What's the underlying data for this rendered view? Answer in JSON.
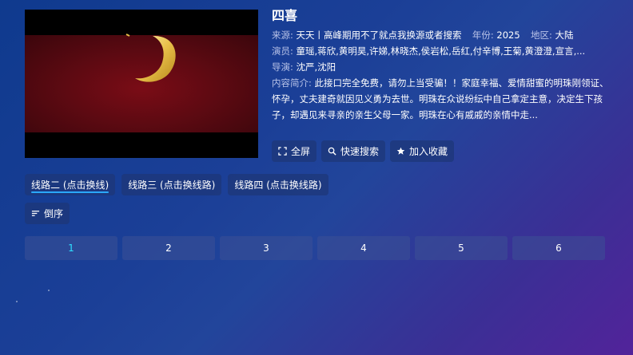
{
  "video": {
    "title": "四喜"
  },
  "meta": {
    "source_label": "来源:",
    "source_value": "天天丨高峰期用不了就点我换源或者搜索",
    "year_label": "年份:",
    "year_value": "2025",
    "region_label": "地区:",
    "region_value": "大陆",
    "cast_label": "演员:",
    "cast_value": "童瑶,蒋欣,黄明昊,许娣,林晓杰,侯岩松,岳红,付辛博,王菊,黄澄澄,宣言,...",
    "director_label": "导演:",
    "director_value": "沈严,沈阳",
    "synopsis_label": "内容简介:",
    "synopsis_value": "此接口完全免费，请勿上当受骗！！家庭幸福、爱情甜蜜的明珠刚领证、怀孕，丈夫建奇就因见义勇为去世。明珠在众说纷纭中自己拿定主意，决定生下孩子，却遇见来寻亲的亲生父母一家。明珠在心有戚戚的亲情中走..."
  },
  "actions": {
    "fullscreen": "全屏",
    "quick_search": "快速搜索",
    "add_favorite": "加入收藏"
  },
  "lines": [
    {
      "label": "线路二 (点击换线)",
      "active": true
    },
    {
      "label": "线路三 (点击换线路)",
      "active": false
    },
    {
      "label": "线路四 (点击换线路)",
      "active": false
    }
  ],
  "sort_label": "倒序",
  "episodes": [
    "1",
    "2",
    "3",
    "4",
    "5",
    "6"
  ],
  "active_episode": "1",
  "colors": {
    "accent": "#2aa8ff",
    "active_episode": "#2ee0ff"
  }
}
